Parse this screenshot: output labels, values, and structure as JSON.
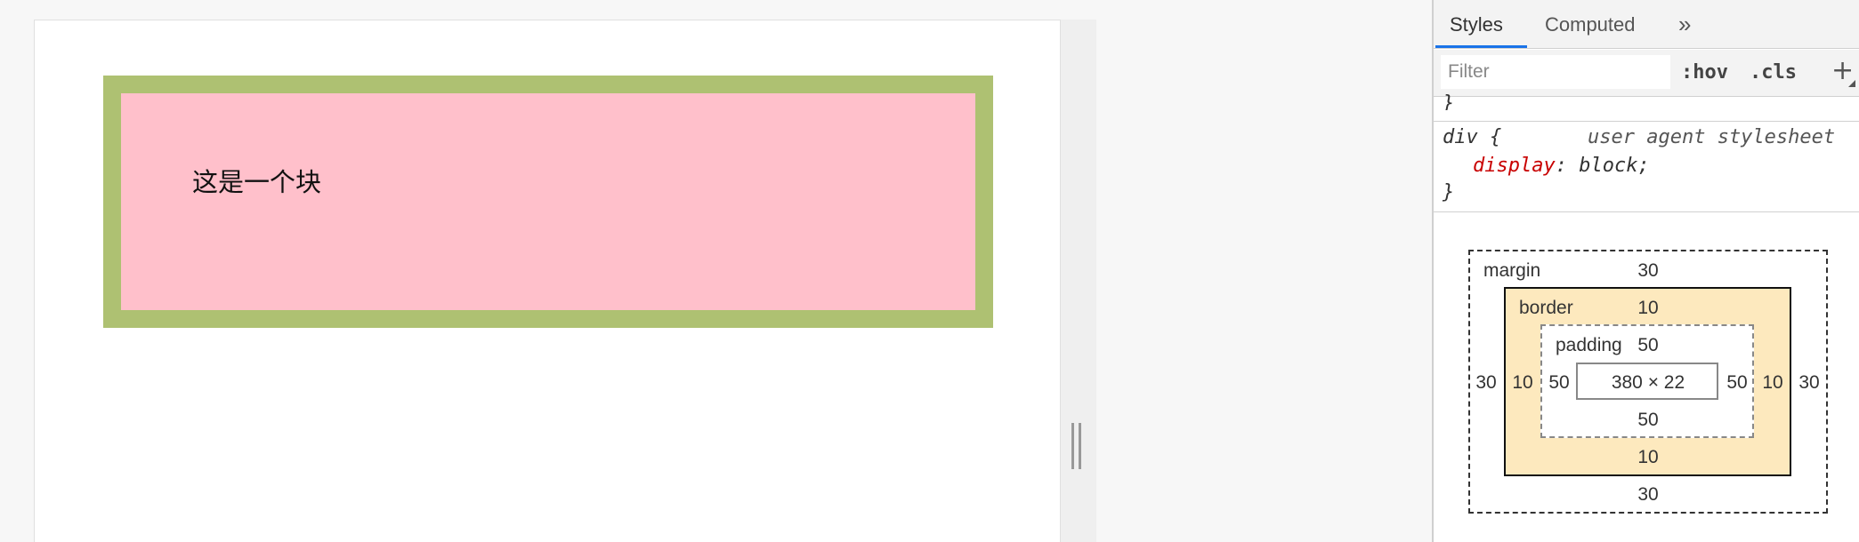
{
  "viewport": {
    "block_text": "这是一个块"
  },
  "devtools": {
    "tabs": [
      {
        "label": "Styles",
        "active": true
      },
      {
        "label": "Computed",
        "active": false
      }
    ],
    "more_tabs_icon": "»",
    "filter": {
      "placeholder": "Filter",
      "value": ""
    },
    "toolbar": {
      "hov": ":hov",
      "cls": ".cls",
      "add": "+"
    },
    "prev_rule_close": "}",
    "rule": {
      "selector": "div {",
      "origin": "user agent stylesheet",
      "property": "display",
      "value": ": block;",
      "close": "}"
    },
    "box_model": {
      "margin_label": "margin",
      "border_label": "border",
      "padding_label": "padding",
      "margin": {
        "top": "30",
        "right": "30",
        "bottom": "30",
        "left": "30"
      },
      "border": {
        "top": "10",
        "right": "10",
        "bottom": "10",
        "left": "10"
      },
      "padding": {
        "top": "50",
        "right": "50",
        "bottom": "50",
        "left": "50"
      },
      "content": "380 × 22"
    }
  },
  "colors": {
    "block_background": "#ffc0cb",
    "block_border": "#aec172",
    "border_box": "#fde9be",
    "active_tab": "#1a73e8",
    "property_name": "#c80000"
  }
}
